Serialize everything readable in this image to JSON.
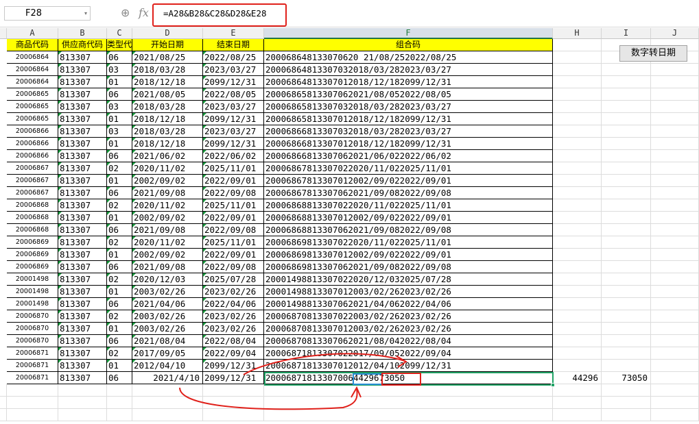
{
  "formula_bar": {
    "cell_ref": "F28",
    "zoom_icon": "zoom-icon",
    "fx_label": "fx",
    "formula": "=A28&B28&C28&D28&E28"
  },
  "columns": [
    "A",
    "B",
    "C",
    "D",
    "E",
    "F",
    "H",
    "I",
    "J"
  ],
  "header_row": [
    "商品代码",
    "供应商代码",
    "类型代",
    "开始日期",
    "结束日期",
    "组合码"
  ],
  "rows": [
    [
      "20006864",
      "813307",
      "06",
      "2021/08/25",
      "2022/08/25",
      "200068648133070620 21/08/252022/08/25"
    ],
    [
      "20006864",
      "813307",
      "03",
      "2018/03/28",
      "2023/03/27",
      "20006864813307032018/03/282023/03/27"
    ],
    [
      "20006864",
      "813307",
      "01",
      "2018/12/18",
      "2099/12/31",
      "20006864813307012018/12/182099/12/31"
    ],
    [
      "20006865",
      "813307",
      "06",
      "2021/08/05",
      "2022/08/05",
      "20006865813307062021/08/052022/08/05"
    ],
    [
      "20006865",
      "813307",
      "03",
      "2018/03/28",
      "2023/03/27",
      "20006865813307032018/03/282023/03/27"
    ],
    [
      "20006865",
      "813307",
      "01",
      "2018/12/18",
      "2099/12/31",
      "20006865813307012018/12/182099/12/31"
    ],
    [
      "20006866",
      "813307",
      "03",
      "2018/03/28",
      "2023/03/27",
      "20006866813307032018/03/282023/03/27"
    ],
    [
      "20006866",
      "813307",
      "01",
      "2018/12/18",
      "2099/12/31",
      "20006866813307012018/12/182099/12/31"
    ],
    [
      "20006866",
      "813307",
      "06",
      "2021/06/02",
      "2022/06/02",
      "20006866813307062021/06/022022/06/02"
    ],
    [
      "20006867",
      "813307",
      "02",
      "2020/11/02",
      "2025/11/01",
      "20006867813307022020/11/022025/11/01"
    ],
    [
      "20006867",
      "813307",
      "01",
      "2002/09/02",
      "2022/09/01",
      "20006867813307012002/09/022022/09/01"
    ],
    [
      "20006867",
      "813307",
      "06",
      "2021/09/08",
      "2022/09/08",
      "20006867813307062021/09/082022/09/08"
    ],
    [
      "20006868",
      "813307",
      "02",
      "2020/11/02",
      "2025/11/01",
      "20006868813307022020/11/022025/11/01"
    ],
    [
      "20006868",
      "813307",
      "01",
      "2002/09/02",
      "2022/09/01",
      "20006868813307012002/09/022022/09/01"
    ],
    [
      "20006868",
      "813307",
      "06",
      "2021/09/08",
      "2022/09/08",
      "20006868813307062021/09/082022/09/08"
    ],
    [
      "20006869",
      "813307",
      "02",
      "2020/11/02",
      "2025/11/01",
      "20006869813307022020/11/022025/11/01"
    ],
    [
      "20006869",
      "813307",
      "01",
      "2002/09/02",
      "2022/09/01",
      "20006869813307012002/09/022022/09/01"
    ],
    [
      "20006869",
      "813307",
      "06",
      "2021/09/08",
      "2022/09/08",
      "20006869813307062021/09/082022/09/08"
    ],
    [
      "20001498",
      "813307",
      "02",
      "2020/12/03",
      "2025/07/28",
      "20001498813307022020/12/032025/07/28"
    ],
    [
      "20001498",
      "813307",
      "01",
      "2003/02/26",
      "2023/02/26",
      "20001498813307012003/02/262023/02/26"
    ],
    [
      "20001498",
      "813307",
      "06",
      "2021/04/06",
      "2022/04/06",
      "20001498813307062021/04/062022/04/06"
    ],
    [
      "20006870",
      "813307",
      "02",
      "2003/02/26",
      "2023/02/26",
      "20006870813307022003/02/262023/02/26"
    ],
    [
      "20006870",
      "813307",
      "01",
      "2003/02/26",
      "2023/02/26",
      "20006870813307012003/02/262023/02/26"
    ],
    [
      "20006870",
      "813307",
      "06",
      "2021/08/04",
      "2022/08/04",
      "20006870813307062021/08/042022/08/04"
    ],
    [
      "20006871",
      "813307",
      "02",
      "2017/09/05",
      "2022/09/04",
      "20006871813307022017/09/052022/09/04"
    ],
    [
      "20006871",
      "813307",
      "01",
      "2012/04/10",
      "2099/12/31",
      "20006871813307012012/04/102099/12/31"
    ]
  ],
  "last_row": {
    "A": "20006871",
    "B": "813307",
    "C": "06",
    "D": "2021/4/10",
    "E": "2099/12/31",
    "F_prefix": "20006871813307006",
    "F_blue": "44296",
    "F_red": "73050",
    "H": "44296",
    "I": "73050"
  },
  "button_label": "数字转日期",
  "colors": {
    "header_yellow": "#ffff00",
    "annotation_red": "#e0201a",
    "annotation_blue": "#2b8fd6",
    "selection_green": "#21a366",
    "error_triangle": "#1a9c3f"
  }
}
